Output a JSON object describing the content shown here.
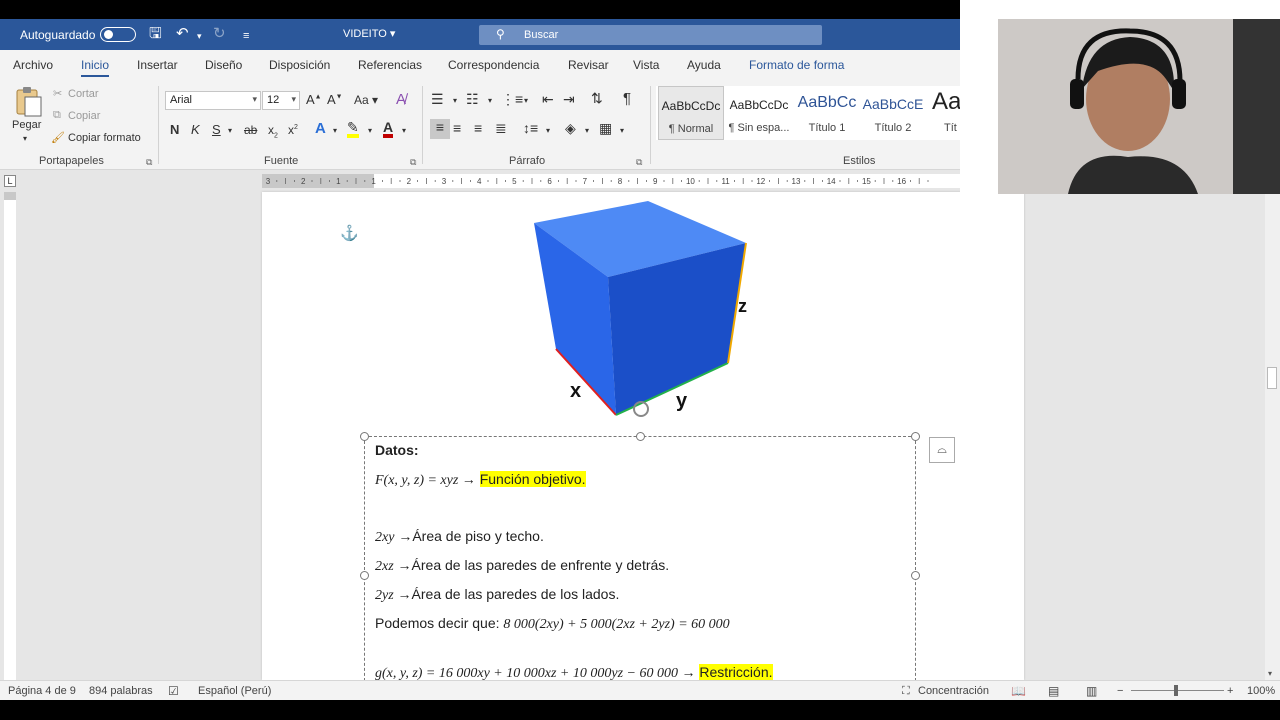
{
  "titlebar": {
    "autosave_label": "Autoguardado",
    "doc_name": "VIDEITO",
    "search_placeholder": "Buscar"
  },
  "tabs": [
    "Archivo",
    "Inicio",
    "Insertar",
    "Diseño",
    "Disposición",
    "Referencias",
    "Correspondencia",
    "Revisar",
    "Vista",
    "Ayuda",
    "Formato de forma"
  ],
  "ribbon": {
    "clipboard": {
      "paste": "Pegar",
      "cut": "Cortar",
      "copy": "Copiar",
      "format_painter": "Copiar formato",
      "label": "Portapapeles"
    },
    "font": {
      "name": "Arial",
      "size": "12",
      "label": "Fuente",
      "bold": "N",
      "italic": "K",
      "underline": "S",
      "strike": "ab",
      "subscript": "x",
      "superscript": "x"
    },
    "paragraph": {
      "label": "Párrafo"
    },
    "styles": {
      "label": "Estilos",
      "items": [
        {
          "sample": "AaBbCcDc",
          "name": "¶ Normal"
        },
        {
          "sample": "AaBbCcDc",
          "name": "¶ Sin espa..."
        },
        {
          "sample": "AaBbCc",
          "name": "Título 1"
        },
        {
          "sample": "AaBbCcE",
          "name": "Título 2"
        },
        {
          "sample": "Aa",
          "name": "Tít"
        }
      ]
    }
  },
  "ruler_numbers": [
    "3",
    "2",
    "1",
    "1",
    "2",
    "3",
    "4",
    "5",
    "6",
    "7",
    "8",
    "9",
    "10",
    "11",
    "12",
    "13",
    "14",
    "15",
    "16"
  ],
  "cube": {
    "label_x": "x",
    "label_y": "y",
    "label_z": "z",
    "color": "#1f5fe0"
  },
  "doc": {
    "heading": "Datos:",
    "line1_math": "F(x, y, z) = xyz →",
    "line1_hl": "Función objetivo.",
    "line2_math": "2xy",
    "line2_text": " →Área de piso y techo.",
    "line3_math": "2xz",
    "line3_text": " →Área de las paredes de enfrente y detrás.",
    "line4_math": "2yz",
    "line4_text": " →Área de las paredes de los lados.",
    "line5_text": "Podemos decir que: ",
    "line5_math": "8 000(2xy) + 5 000(2xz + 2yz) = 60 000",
    "line6_math": "g(x, y, z) = 16 000xy + 10 000xz + 10 000yz − 60 000 →",
    "line6_hl": "Restricción."
  },
  "status": {
    "page": "Página 4 de 9",
    "words": "894 palabras",
    "language": "Español (Perú)",
    "focus": "Concentración",
    "zoom": "100%"
  },
  "colors": {
    "accent": "#2b579a",
    "highlight": "#ffff00"
  }
}
